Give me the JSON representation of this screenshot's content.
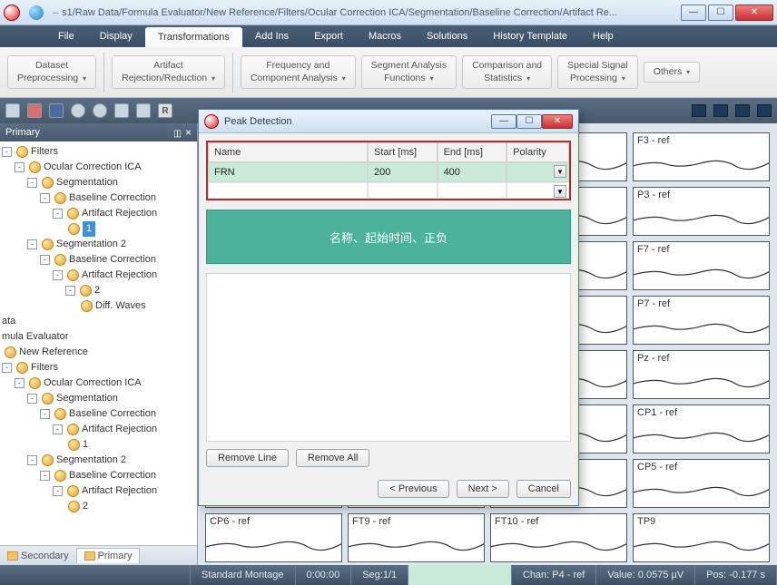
{
  "title": "s1/Raw Data/Formula Evaluator/New Reference/Filters/Ocular Correction ICA/Segmentation/Baseline Correction/Artifact Re...",
  "menu": [
    "File",
    "Display",
    "Transformations",
    "Add Ins",
    "Export",
    "Macros",
    "Solutions",
    "History Template",
    "Help"
  ],
  "menu_active": 2,
  "ribbon": [
    "Dataset\nPreprocessing",
    "Artifact\nRejection/Reduction",
    "Frequency and\nComponent Analysis",
    "Segment Analysis\nFunctions",
    "Comparison and\nStatistics",
    "Special Signal\nProcessing",
    "Others"
  ],
  "side": {
    "title": "Primary",
    "tree": [
      {
        "ind": 0,
        "tw": "-",
        "label": "Filters"
      },
      {
        "ind": 1,
        "tw": "-",
        "label": "Ocular Correction ICA"
      },
      {
        "ind": 2,
        "tw": "-",
        "label": "Segmentation"
      },
      {
        "ind": 3,
        "tw": "-",
        "label": "Baseline Correction"
      },
      {
        "ind": 4,
        "tw": "-",
        "label": "Artifact Rejection"
      },
      {
        "ind": 5,
        "tw": "",
        "label": "1",
        "sel": true
      },
      {
        "ind": 2,
        "tw": "-",
        "label": "Segmentation 2"
      },
      {
        "ind": 3,
        "tw": "-",
        "label": "Baseline Correction"
      },
      {
        "ind": 4,
        "tw": "-",
        "label": "Artifact Rejection"
      },
      {
        "ind": 5,
        "tw": "-",
        "label": "2"
      },
      {
        "ind": 6,
        "tw": "",
        "label": "Diff. Waves"
      },
      {
        "ind": 0,
        "tw": "",
        "label": "ata",
        "nogear": true
      },
      {
        "ind": 0,
        "tw": "",
        "label": "mula Evaluator",
        "nogear": true
      },
      {
        "ind": 0,
        "tw": "",
        "label": "New Reference"
      },
      {
        "ind": 0,
        "tw": "-",
        "label": "Filters"
      },
      {
        "ind": 1,
        "tw": "-",
        "label": "Ocular Correction ICA"
      },
      {
        "ind": 2,
        "tw": "-",
        "label": "Segmentation"
      },
      {
        "ind": 3,
        "tw": "-",
        "label": "Baseline Correction"
      },
      {
        "ind": 4,
        "tw": "-",
        "label": "Artifact Rejection"
      },
      {
        "ind": 5,
        "tw": "",
        "label": "1"
      },
      {
        "ind": 2,
        "tw": "-",
        "label": "Segmentation 2"
      },
      {
        "ind": 3,
        "tw": "-",
        "label": "Baseline Correction"
      },
      {
        "ind": 4,
        "tw": "-",
        "label": "Artifact Rejection"
      },
      {
        "ind": 5,
        "tw": "",
        "label": "2"
      }
    ],
    "tabs": [
      "Secondary",
      "Primary"
    ],
    "tab_active": 1
  },
  "dialog": {
    "title": "Peak Detection",
    "cols": [
      "Name",
      "Start [ms]",
      "End [ms]",
      "Polarity"
    ],
    "row": {
      "name": "FRN",
      "start": "200",
      "end": "400",
      "pol": ""
    },
    "annotation": "名称、起始时间、正负",
    "remove_line": "Remove Line",
    "remove_all": "Remove All",
    "prev": "< Previous",
    "next": "Next >",
    "cancel": "Cancel"
  },
  "channels": [
    "",
    "",
    "",
    "F3 - ref",
    "",
    "",
    "",
    "P3 - ref",
    "",
    "",
    "",
    "F7 - ref",
    "",
    "",
    "",
    "P7 - ref",
    "",
    "",
    "",
    "Pz - ref",
    "",
    "",
    "",
    "CP1 - ref",
    "",
    "",
    "",
    "CP5 - ref",
    "CP6 - ref",
    "FT9 - ref",
    "FT10 - ref",
    "TP9"
  ],
  "status": {
    "montage": "Standard Montage",
    "time": "0:00:00",
    "seg": "Seg:1/1",
    "chan": "Chan:  P4 - ref",
    "value": "Value:  0.0575 µV",
    "pos": "Pos:  -0.177 s"
  }
}
